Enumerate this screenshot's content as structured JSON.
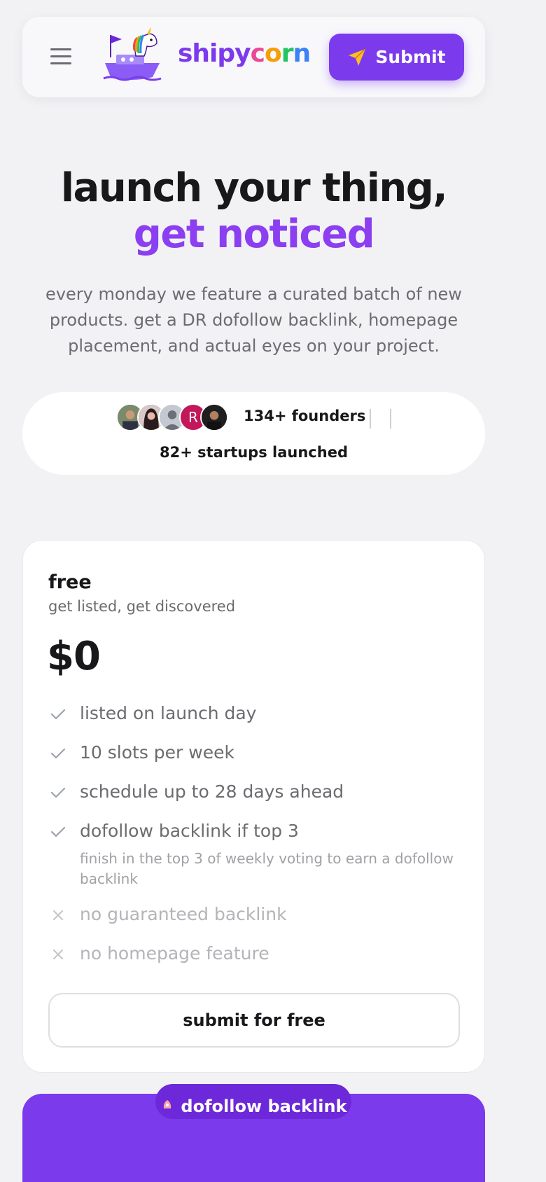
{
  "header": {
    "brand": {
      "part1": "shipy",
      "part2": "c",
      "part3": "o",
      "part4": "r",
      "part5": "n"
    },
    "submit_label": "Submit",
    "colors": {
      "accent": "#7c3aed",
      "send_icon": "#fbbf24"
    }
  },
  "hero": {
    "title_main": "launch your thing, ",
    "title_accent": "get noticed",
    "subtitle": "every monday we feature a curated batch of new products. get a DR dofollow backlink, homepage placement, and actual eyes on your project."
  },
  "stats": {
    "avatar_initial": "R",
    "founders": "134+ founders",
    "launched": "82+ startups launched"
  },
  "plan": {
    "name": "free",
    "tagline": "get listed, get discovered",
    "price": "$0",
    "features": [
      {
        "label": "listed on launch day",
        "included": true
      },
      {
        "label": "10 slots per week",
        "included": true
      },
      {
        "label": "schedule up to 28 days ahead",
        "included": true
      },
      {
        "label": "dofollow backlink if top 3",
        "included": true,
        "note": "finish in the top 3 of weekly voting to earn a dofollow backlink"
      },
      {
        "label": "no guaranteed backlink",
        "included": false
      },
      {
        "label": "no homepage feature",
        "included": false
      }
    ],
    "cta": "submit for free"
  },
  "next_plan": {
    "badge": "dofollow backlink"
  }
}
